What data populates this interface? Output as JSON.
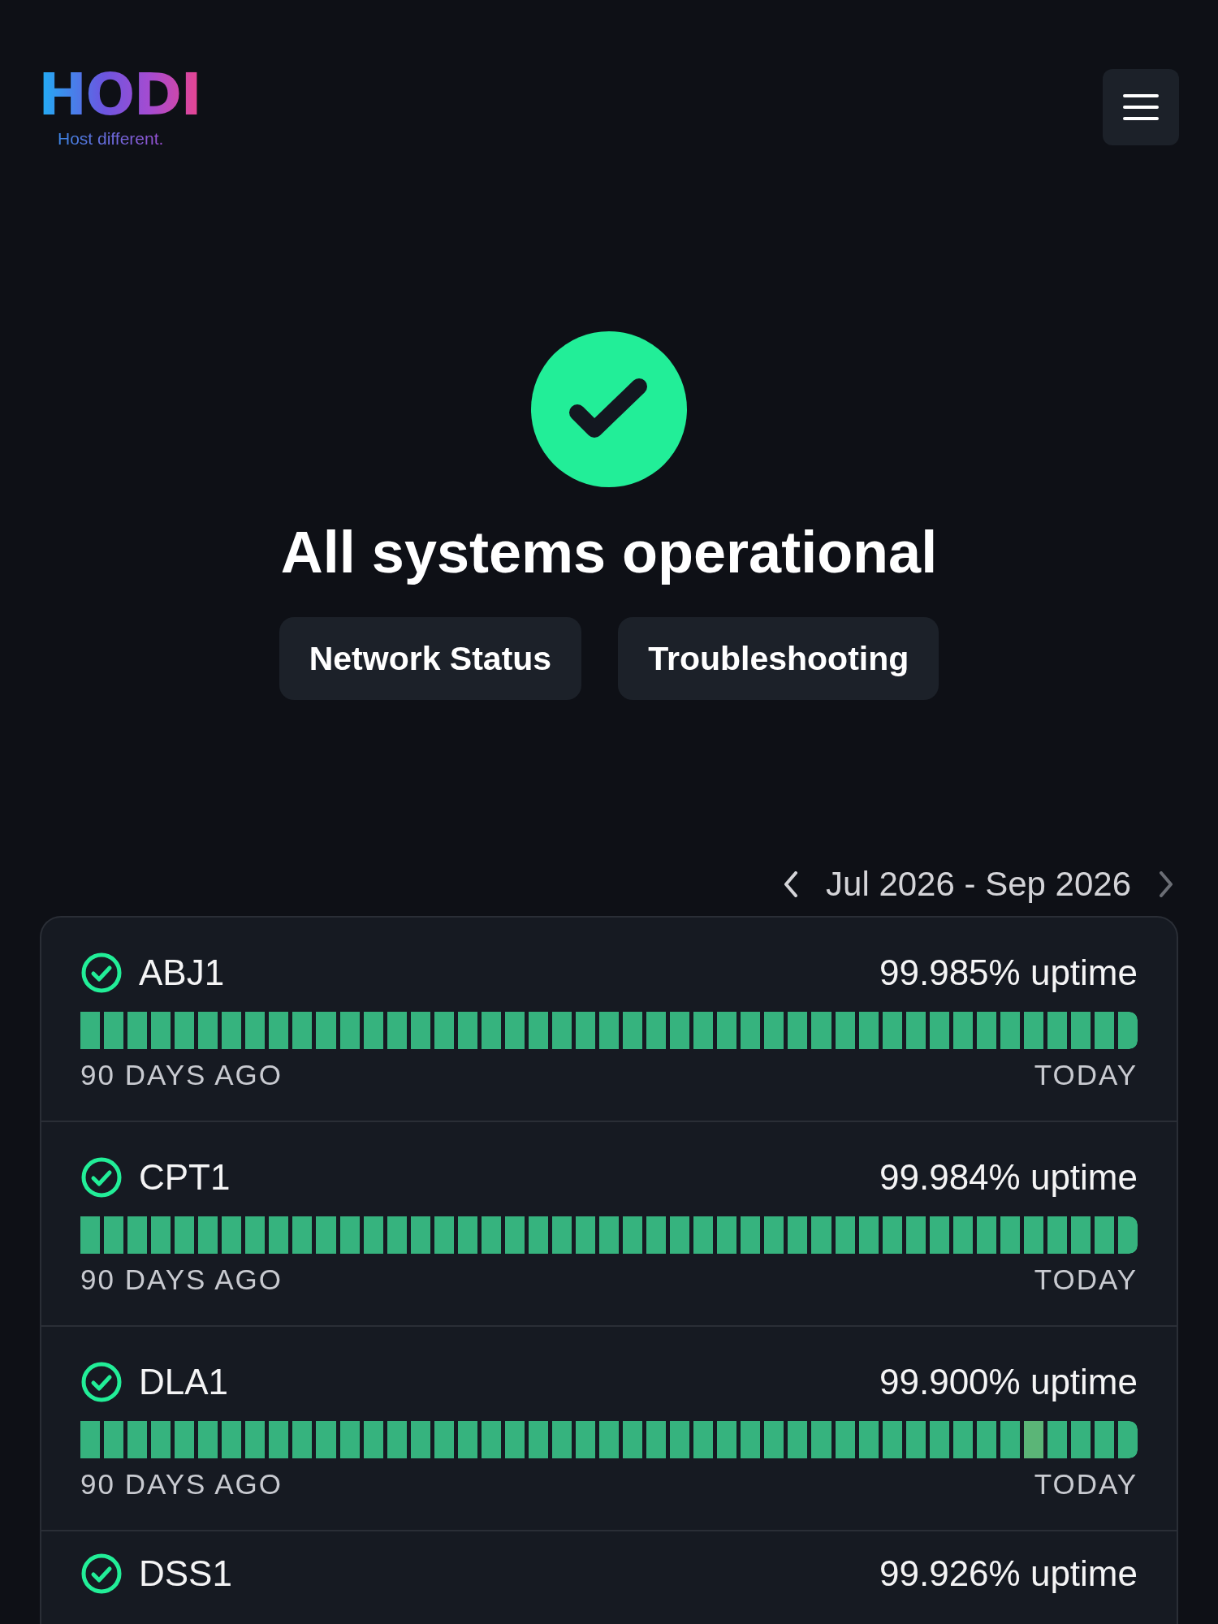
{
  "header": {
    "logo": "HODI",
    "tagline": "Host different."
  },
  "status": {
    "title": "All systems operational",
    "links": [
      "Network Status",
      "Troubleshooting"
    ]
  },
  "range": {
    "label": "Jul 2026 - Sep 2026"
  },
  "monitors": [
    {
      "kind": "full",
      "name": "ABJ1",
      "uptime": "99.985% uptime",
      "start_label": "90 DAYS AGO",
      "end_label": "TODAY",
      "bars": [
        {
          "color": "#36b37e"
        },
        {
          "color": "#36b37e"
        },
        {
          "color": "#36b37e"
        },
        {
          "color": "#36b37e"
        },
        {
          "color": "#36b37e"
        },
        {
          "color": "#36b37e"
        },
        {
          "color": "#36b37e"
        },
        {
          "color": "#36b37e"
        },
        {
          "color": "#36b37e"
        },
        {
          "color": "#36b37e"
        },
        {
          "color": "#36b37e"
        },
        {
          "color": "#36b37e"
        },
        {
          "color": "#36b37e"
        },
        {
          "color": "#36b37e"
        },
        {
          "color": "#36b37e"
        },
        {
          "color": "#36b37e"
        },
        {
          "color": "#36b37e"
        },
        {
          "color": "#36b37e"
        },
        {
          "color": "#36b37e"
        },
        {
          "color": "#36b37e"
        },
        {
          "color": "#36b37e"
        },
        {
          "color": "#36b37e"
        },
        {
          "color": "#36b37e"
        },
        {
          "color": "#36b37e"
        },
        {
          "color": "#36b37e"
        },
        {
          "color": "#36b37e"
        },
        {
          "color": "#36b37e"
        },
        {
          "color": "#36b37e"
        },
        {
          "color": "#36b37e"
        },
        {
          "color": "#36b37e"
        },
        {
          "color": "#36b37e"
        },
        {
          "color": "#36b37e"
        },
        {
          "color": "#36b37e"
        },
        {
          "color": "#36b37e"
        },
        {
          "color": "#36b37e"
        },
        {
          "color": "#36b37e"
        },
        {
          "color": "#36b37e"
        },
        {
          "color": "#36b37e"
        },
        {
          "color": "#36b37e"
        },
        {
          "color": "#36b37e"
        },
        {
          "color": "#36b37e"
        },
        {
          "color": "#36b37e"
        },
        {
          "color": "#36b37e"
        },
        {
          "color": "#36b37e"
        },
        {
          "color": "#36b37e"
        }
      ]
    },
    {
      "kind": "full",
      "name": "CPT1",
      "uptime": "99.984% uptime",
      "start_label": "90 DAYS AGO",
      "end_label": "TODAY",
      "bars": [
        {
          "color": "#36b37e"
        },
        {
          "color": "#36b37e"
        },
        {
          "color": "#36b37e"
        },
        {
          "color": "#36b37e"
        },
        {
          "color": "#36b37e"
        },
        {
          "color": "#36b37e"
        },
        {
          "color": "#36b37e"
        },
        {
          "color": "#36b37e"
        },
        {
          "color": "#36b37e"
        },
        {
          "color": "#36b37e"
        },
        {
          "color": "#36b37e"
        },
        {
          "color": "#36b37e"
        },
        {
          "color": "#36b37e"
        },
        {
          "color": "#36b37e"
        },
        {
          "color": "#36b37e"
        },
        {
          "color": "#36b37e"
        },
        {
          "color": "#36b37e"
        },
        {
          "color": "#36b37e"
        },
        {
          "color": "#36b37e"
        },
        {
          "color": "#36b37e"
        },
        {
          "color": "#36b37e"
        },
        {
          "color": "#36b37e"
        },
        {
          "color": "#36b37e"
        },
        {
          "color": "#36b37e"
        },
        {
          "color": "#36b37e"
        },
        {
          "color": "#36b37e"
        },
        {
          "color": "#36b37e"
        },
        {
          "color": "#36b37e"
        },
        {
          "color": "#36b37e"
        },
        {
          "color": "#36b37e"
        },
        {
          "color": "#36b37e"
        },
        {
          "color": "#36b37e"
        },
        {
          "color": "#36b37e"
        },
        {
          "color": "#36b37e"
        },
        {
          "color": "#36b37e"
        },
        {
          "color": "#36b37e"
        },
        {
          "color": "#36b37e"
        },
        {
          "color": "#36b37e"
        },
        {
          "color": "#36b37e"
        },
        {
          "color": "#36b37e"
        },
        {
          "color": "#36b37e"
        },
        {
          "color": "#36b37e"
        },
        {
          "color": "#36b37e"
        },
        {
          "color": "#36b37e"
        },
        {
          "color": "#36b37e"
        }
      ]
    },
    {
      "kind": "full",
      "name": "DLA1",
      "uptime": "99.900% uptime",
      "start_label": "90 DAYS AGO",
      "end_label": "TODAY",
      "bars": [
        {
          "color": "#36b37e"
        },
        {
          "color": "#36b37e"
        },
        {
          "color": "#36b37e"
        },
        {
          "color": "#36b37e"
        },
        {
          "color": "#36b37e"
        },
        {
          "color": "#36b37e"
        },
        {
          "color": "#36b37e"
        },
        {
          "color": "#36b37e"
        },
        {
          "color": "#36b37e"
        },
        {
          "color": "#36b37e"
        },
        {
          "color": "#36b37e"
        },
        {
          "color": "#36b37e"
        },
        {
          "color": "#36b37e"
        },
        {
          "color": "#36b37e"
        },
        {
          "color": "#36b37e"
        },
        {
          "color": "#36b37e"
        },
        {
          "color": "#36b37e"
        },
        {
          "color": "#36b37e"
        },
        {
          "color": "#36b37e"
        },
        {
          "color": "#36b37e"
        },
        {
          "color": "#36b37e"
        },
        {
          "color": "#36b37e"
        },
        {
          "color": "#36b37e"
        },
        {
          "color": "#36b37e"
        },
        {
          "color": "#36b37e"
        },
        {
          "color": "#36b37e"
        },
        {
          "color": "#36b37e"
        },
        {
          "color": "#36b37e"
        },
        {
          "color": "#36b37e"
        },
        {
          "color": "#36b37e"
        },
        {
          "color": "#36b37e"
        },
        {
          "color": "#36b37e"
        },
        {
          "color": "#36b37e"
        },
        {
          "color": "#36b37e"
        },
        {
          "color": "#36b37e"
        },
        {
          "color": "#36b37e"
        },
        {
          "color": "#36b37e"
        },
        {
          "color": "#36b37e"
        },
        {
          "color": "#36b37e"
        },
        {
          "color": "#36b37e"
        },
        {
          "color": "#5bb577"
        },
        {
          "color": "#36b37e"
        },
        {
          "color": "#36b37e"
        },
        {
          "color": "#36b37e"
        },
        {
          "color": "#36b37e"
        }
      ]
    },
    {
      "kind": "header_only",
      "name": "DSS1",
      "uptime": "99.926% uptime"
    }
  ]
}
